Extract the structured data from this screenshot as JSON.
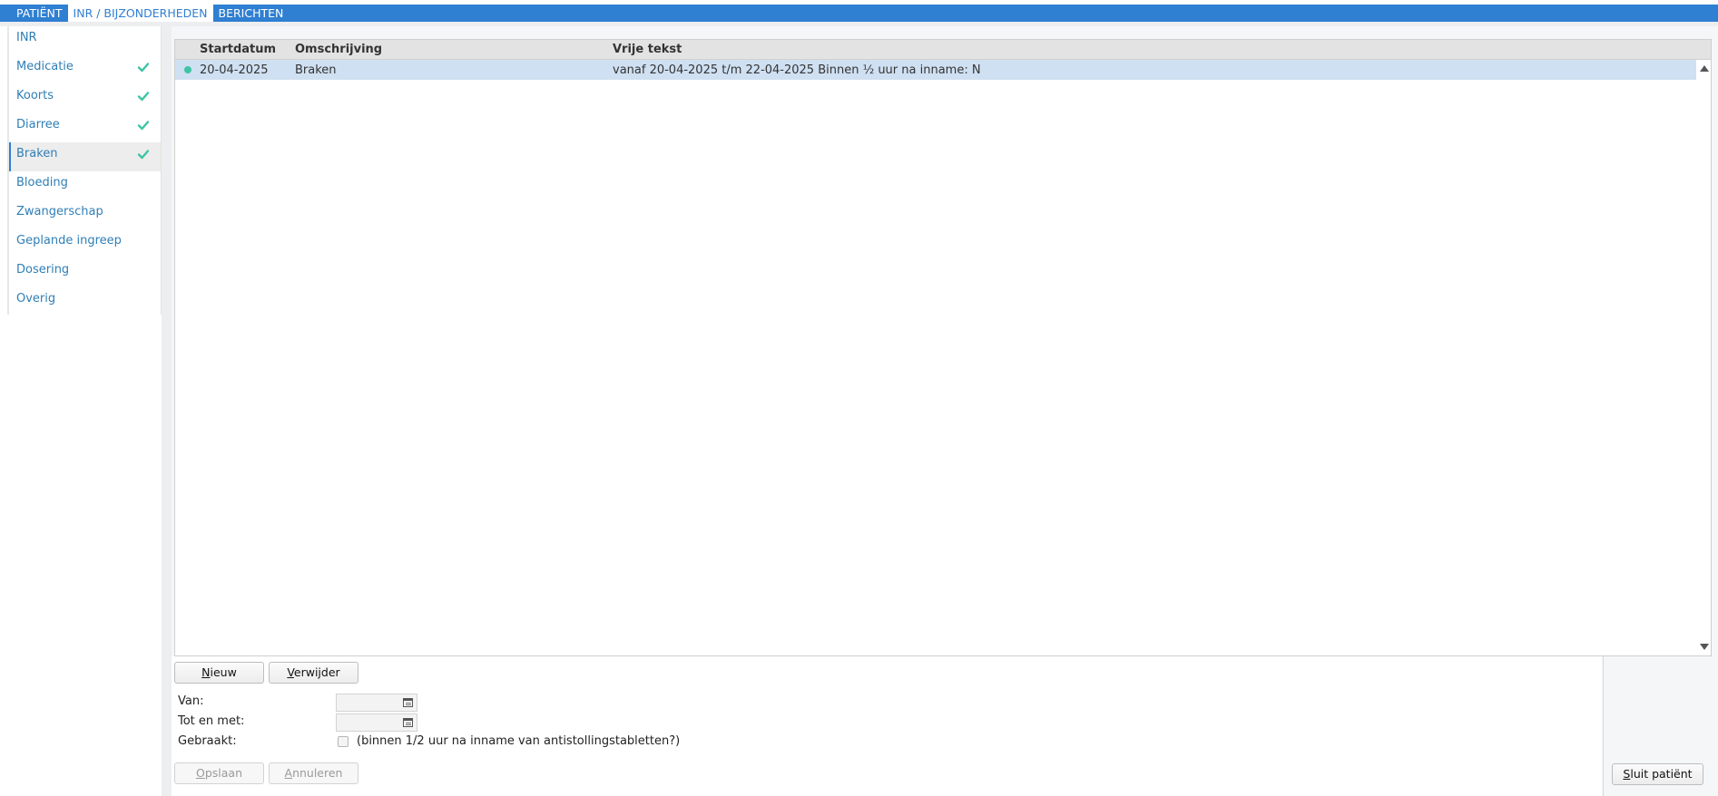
{
  "tabs": [
    {
      "label": "PATIËNT",
      "active": false
    },
    {
      "label": "INR / BIJZONDERHEDEN",
      "active": true
    },
    {
      "label": "BERICHTEN",
      "active": false
    }
  ],
  "sidebar": {
    "items": [
      {
        "label": "INR",
        "checked": false
      },
      {
        "label": "Medicatie",
        "checked": true
      },
      {
        "label": "Koorts",
        "checked": true
      },
      {
        "label": "Diarree",
        "checked": true
      },
      {
        "label": "Braken",
        "checked": true,
        "selected": true
      },
      {
        "label": "Bloeding",
        "checked": false
      },
      {
        "label": "Zwangerschap",
        "checked": false
      },
      {
        "label": "Geplande ingreep",
        "checked": false
      },
      {
        "label": "Dosering",
        "checked": false
      },
      {
        "label": "Overig",
        "checked": false
      }
    ]
  },
  "grid": {
    "columns": [
      "Startdatum",
      "Omschrijving",
      "Vrije tekst"
    ],
    "rows": [
      {
        "startdatum": "20-04-2025",
        "omschrijving": "Braken",
        "vrije_tekst": "vanaf 20-04-2025 t/m 22-04-2025 Binnen ½ uur na inname: N",
        "status_color": "#3ec4a4"
      }
    ]
  },
  "buttons": {
    "nieuw_first": "N",
    "nieuw_rest": "ieuw",
    "verwijder_first": "V",
    "verwijder_rest": "erwijder",
    "opslaan_first": "O",
    "opslaan_rest": "pslaan",
    "annuleren_first": "A",
    "annuleren_rest": "nnuleren",
    "sluit_first": "S",
    "sluit_rest": "luit patiënt"
  },
  "form": {
    "van_label": "Van:",
    "van_value": "",
    "tot_label": "Tot en met:",
    "tot_value": "",
    "gebraakt_label": "Gebraakt:",
    "gebraakt_checked": false,
    "gebraakt_hint": "(binnen 1/2 uur na inname van antistollingstabletten?)"
  },
  "colors": {
    "accent": "#2f7fd2",
    "link": "#2f7fb6",
    "check": "#3ec4a4",
    "row_selected": "#cfe0f2"
  }
}
